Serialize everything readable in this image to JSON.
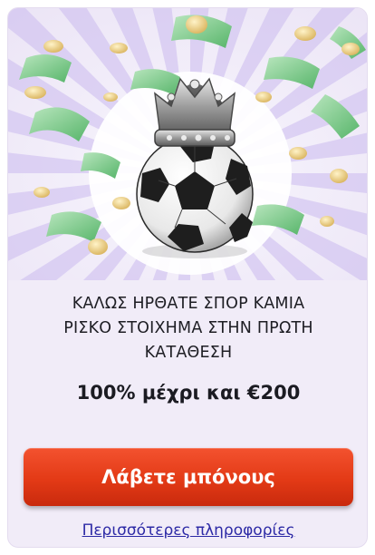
{
  "promo": {
    "headline_line1": "ΚΑΛΩΣ ΗΡΘΑΤΕ ΣΠΟΡ ΚΑΜΙΑ",
    "headline_line2": "ΡΙΣΚΟ ΣΤΟΙΧΗΜΑ ΣΤΗΝ ΠΡΩΤΗ",
    "headline_line3": "ΚΑΤΑΘΕΣΗ",
    "offer": "100% μέχρι και €200",
    "cta_label": "Λάβετε μπόνους",
    "more_info_label": "Περισσότερες πληροφορίες"
  },
  "hero": {
    "icons": [
      "money-rain-illustration",
      "soccer-ball-icon",
      "crown-icon"
    ]
  },
  "colors": {
    "card_background": "#f1ecf8",
    "ray_color": "#cbb9ee",
    "cta_red": "#e33a16",
    "link_blue": "#2d2aa6",
    "text_dark": "#1e1e24"
  }
}
